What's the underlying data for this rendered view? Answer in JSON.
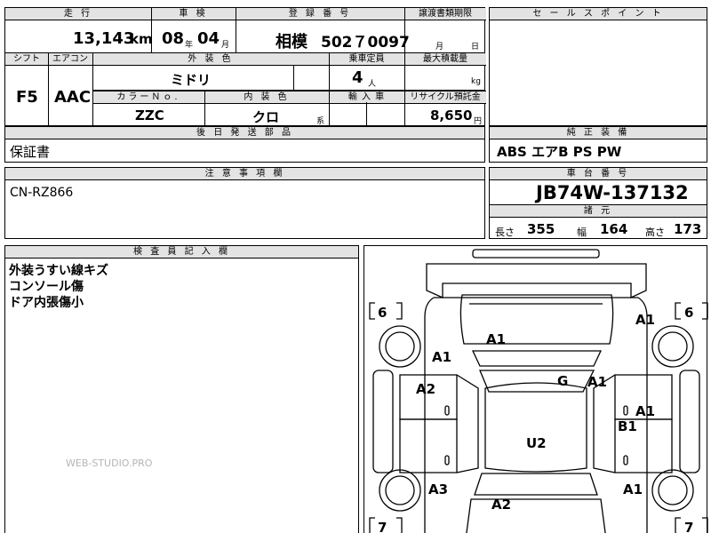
{
  "main_table": {
    "headers": {
      "mileage": "走 行",
      "inspection": "車 検",
      "registration": "登 録 番 号",
      "transfer": "譲渡書類期限",
      "shift": "シフト",
      "aircon": "エアコン",
      "exterior_color": "外 装 色",
      "capacity": "乗車定員",
      "max_load": "最大積載量",
      "color_no": "カラーＮｏ.",
      "interior_color": "内 装 色",
      "import": "輸 入 車",
      "recycle": "リサイクル預託金"
    },
    "mileage_value": "13,143",
    "mileage_unit": "km",
    "inspection_year": "08",
    "inspection_year_unit": "年",
    "inspection_month": "04",
    "inspection_month_unit": "月",
    "plate_region": "相模",
    "plate_number": "502７0097",
    "transfer_month_unit": "月",
    "transfer_day_unit": "日",
    "shift_value": "F5",
    "aircon_value": "AAC",
    "exterior_color_value": "ミドリ",
    "capacity_value": "4",
    "capacity_unit": "人",
    "max_load_unit": "kg",
    "color_no_value": "ZZC",
    "interior_color_value": "クロ",
    "interior_color_suffix": "系",
    "recycle_value": "8,650",
    "recycle_unit": "円"
  },
  "sales_point": {
    "header": "セ ー ル ス ポ イ ン ト"
  },
  "later_parts": {
    "header": "後 日 発 送 部 品",
    "content": "保証書"
  },
  "genuine_equipment": {
    "header": "純 正 装 備",
    "content": "ABS エアB PS PW"
  },
  "notes": {
    "header": "注 意 事 項 欄",
    "content": "CN-RZ866"
  },
  "chassis": {
    "header": "車 台 番 号",
    "number": "JB74W-137132",
    "dims_header": "諸 元",
    "length_label": "長さ",
    "length_value": "355",
    "width_label": "幅",
    "width_value": "164",
    "height_label": "高さ",
    "height_value": "173"
  },
  "inspector": {
    "header": "検 査 員 記 入 欄",
    "lines": [
      "外装うすい線キズ",
      "コンソール傷",
      "ドア内張傷小"
    ],
    "watermark": "WEB-STUDIO.PRO"
  },
  "diagram": {
    "tire_fl": "6",
    "tire_fr": "6",
    "tire_rl": "7",
    "tire_rr": "7",
    "marks": {
      "hood": "A1",
      "fl_fender_top": "A1",
      "fl_fender": "A1",
      "fl_door": "A2",
      "fr_fender": "A1",
      "roof_g": "G",
      "roof_right": "A1",
      "fr_door": "A1",
      "fr_door_b": "B1",
      "roof": "U2",
      "rl_quarter": "A3",
      "rr_quarter": "A1",
      "rear": "A2"
    }
  }
}
